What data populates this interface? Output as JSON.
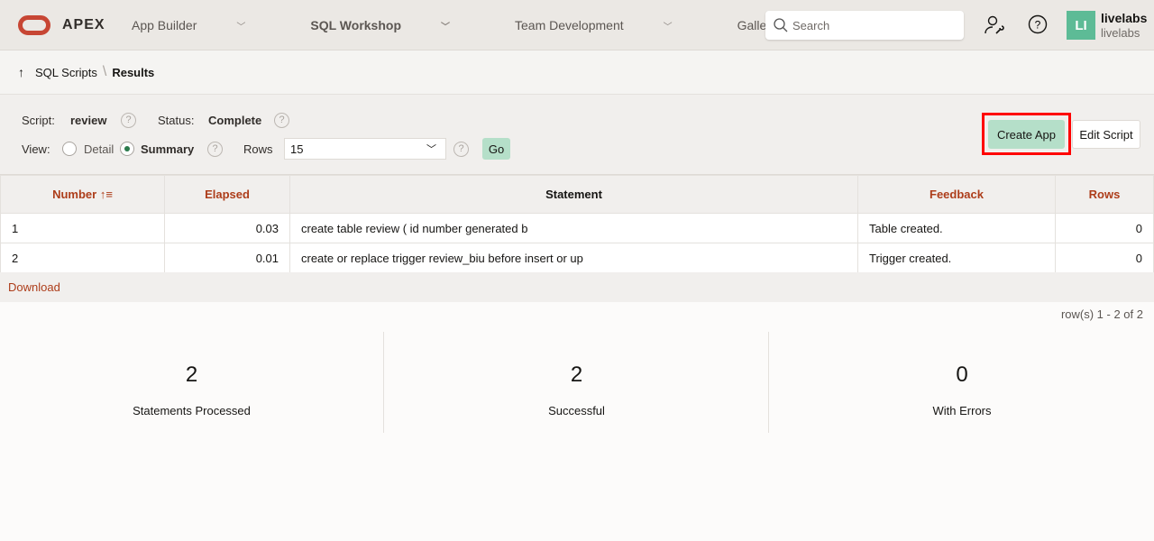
{
  "header": {
    "brand": "APEX",
    "nav": [
      {
        "label": "App Builder"
      },
      {
        "label": "SQL Workshop"
      },
      {
        "label": "Team Development"
      },
      {
        "label": "Gallery"
      }
    ],
    "search_placeholder": "Search",
    "avatar_initials": "LI",
    "user_name": "livelabs",
    "user_workspace": "livelabs",
    "accent": "#c74634"
  },
  "breadcrumb": {
    "parent": "SQL Scripts",
    "current": "Results"
  },
  "form": {
    "script_label": "Script:",
    "script_value": "review",
    "status_label": "Status:",
    "status_value": "Complete",
    "view_label": "View:",
    "view_options": [
      "Detail",
      "Summary"
    ],
    "view_selected": "Summary",
    "rows_label": "Rows",
    "rows_value": "15",
    "go": "Go",
    "help": "?"
  },
  "actions": {
    "create_app": "Create App",
    "edit_script": "Edit Script"
  },
  "table": {
    "headers": [
      "Number",
      "Elapsed",
      "Statement",
      "Feedback",
      "Rows"
    ],
    "rows": [
      [
        "1",
        "0.03",
        "create table review ( id number generated b",
        "Table created.",
        "0"
      ],
      [
        "2",
        "0.01",
        "create or replace trigger review_biu before insert or up",
        "Trigger created.",
        "0"
      ]
    ]
  },
  "download": "Download",
  "row_count": "row(s) 1 - 2 of 2",
  "stats": [
    {
      "value": "2",
      "label": "Statements Processed"
    },
    {
      "value": "2",
      "label": "Successful"
    },
    {
      "value": "0",
      "label": "With Errors"
    }
  ]
}
